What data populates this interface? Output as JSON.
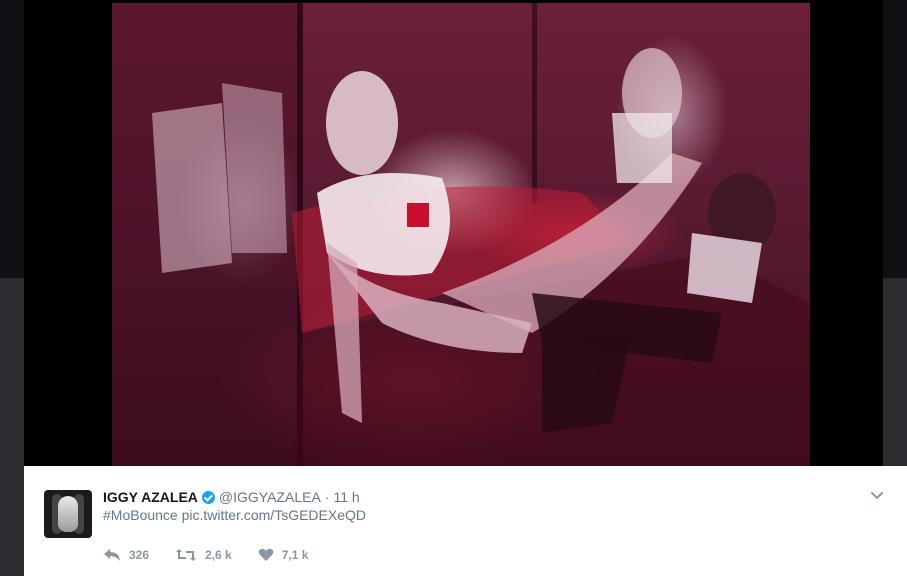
{
  "tweet": {
    "display_name": "IGGY AZALEA",
    "handle": "@IGGYAZALEA",
    "separator": "·",
    "time": "11 h",
    "hashtag": "#MoBounce",
    "link_text": "pic.twitter.com/TsGEDEXeQD",
    "actions": {
      "reply_count": "326",
      "retweet_count": "2,6 k",
      "like_count": "7,1 k"
    }
  },
  "icons": {
    "reply": "reply-icon",
    "retweet": "retweet-icon",
    "like": "heart-icon",
    "more": "chevron-down-icon",
    "verified": "verified-badge-icon"
  },
  "colors": {
    "verified": "#1da1f2",
    "secondary_text": "#657786",
    "action_gray": "#8899a6",
    "name_text": "#14171a"
  }
}
